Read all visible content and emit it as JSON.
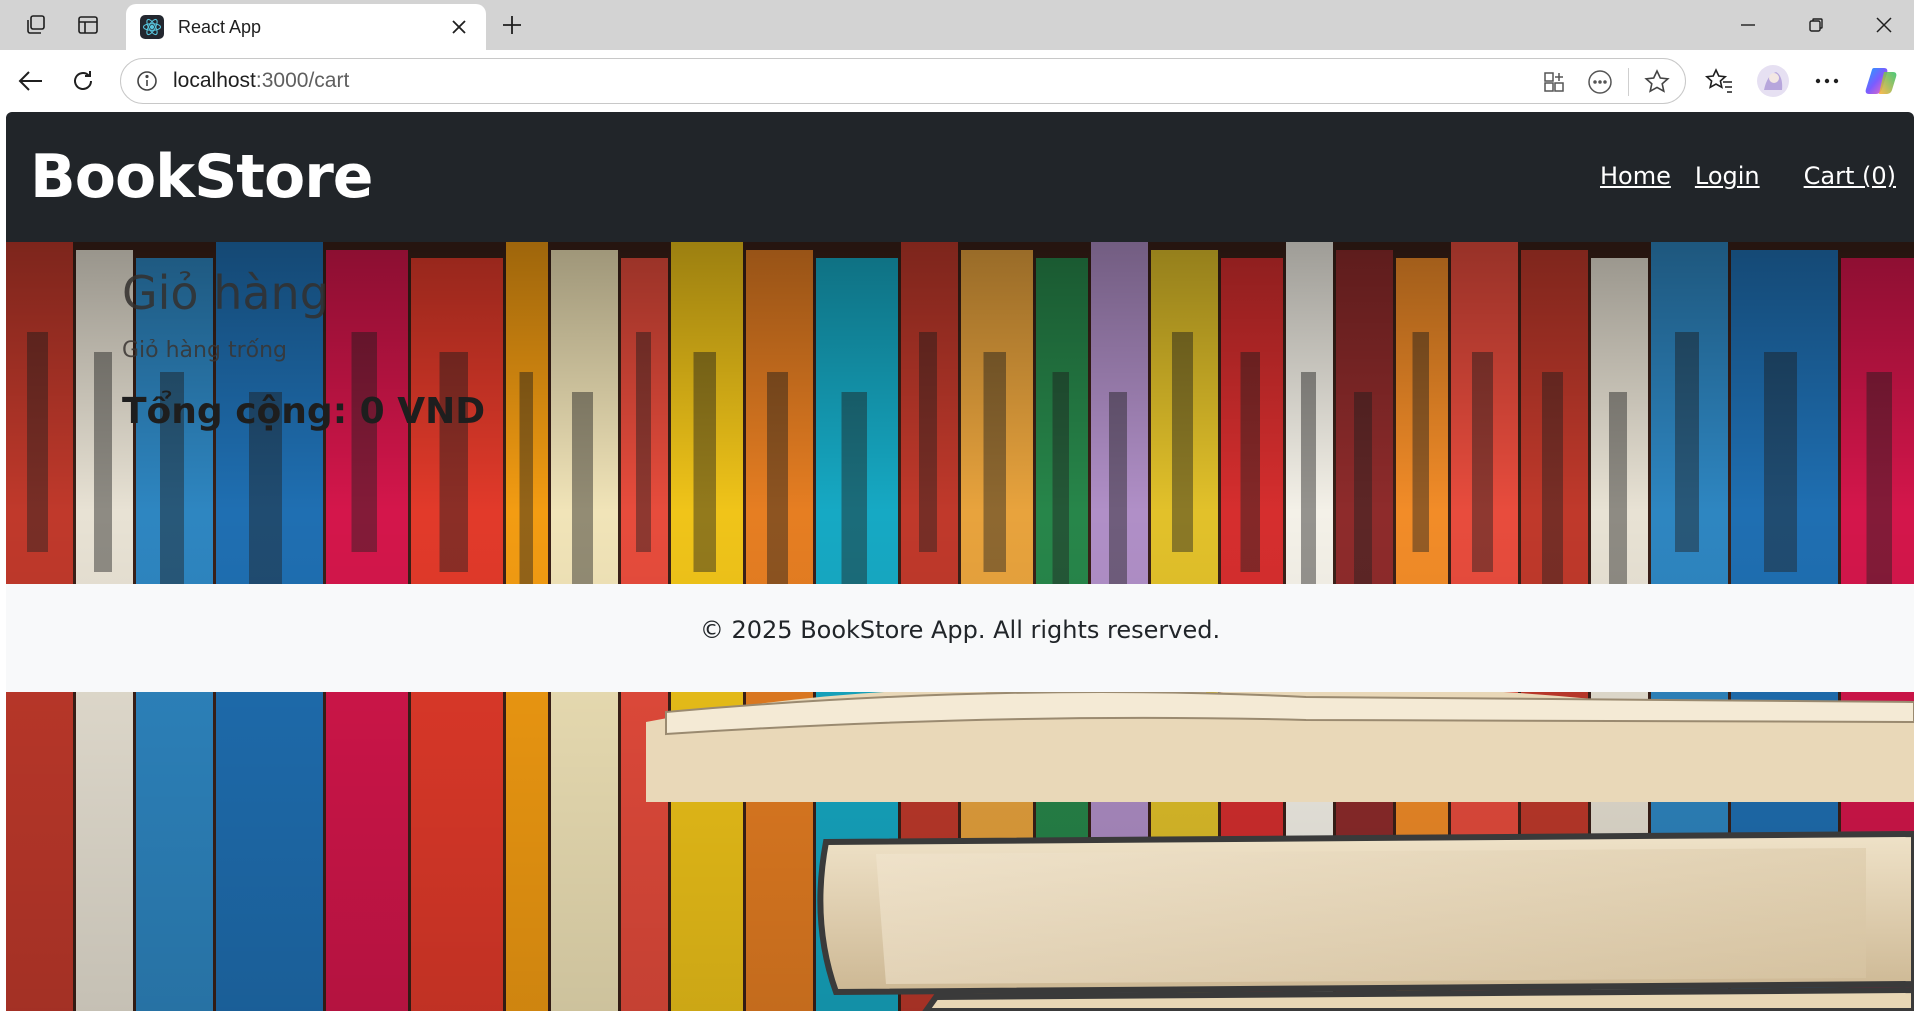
{
  "browser": {
    "tab_title": "React App",
    "url_host": "localhost",
    "url_path": ":3000/cart"
  },
  "icons": {
    "workspaces": "workspaces-icon",
    "tab_actions": "tab-actions-icon",
    "favicon": "react-logo-icon",
    "close_tab": "close-icon",
    "new_tab": "plus-icon",
    "minimize": "minimize-icon",
    "restore": "restore-icon",
    "close_window": "close-icon",
    "back": "back-arrow-icon",
    "refresh": "refresh-icon",
    "site_info": "info-icon",
    "apps": "apps-icon",
    "more_page": "more-circle-icon",
    "favorite": "star-icon",
    "favorites": "favorites-icon",
    "profile": "avatar-icon",
    "settings_more": "ellipsis-icon",
    "copilot": "copilot-icon"
  },
  "navbar": {
    "brand": "BookStore",
    "links": {
      "home": "Home",
      "login": "Login",
      "cart": "Cart (0)"
    }
  },
  "cart": {
    "title": "Giỏ hàng",
    "empty_message": "Giỏ hàng trống",
    "total": "Tổng cộng: 0 VND"
  },
  "footer": {
    "text": "© 2025 BookStore App. All rights reserved."
  },
  "colors": {
    "navbar_bg": "#212529",
    "footer_bg": "#f8f9fa",
    "brand_text": "#ffffff"
  }
}
